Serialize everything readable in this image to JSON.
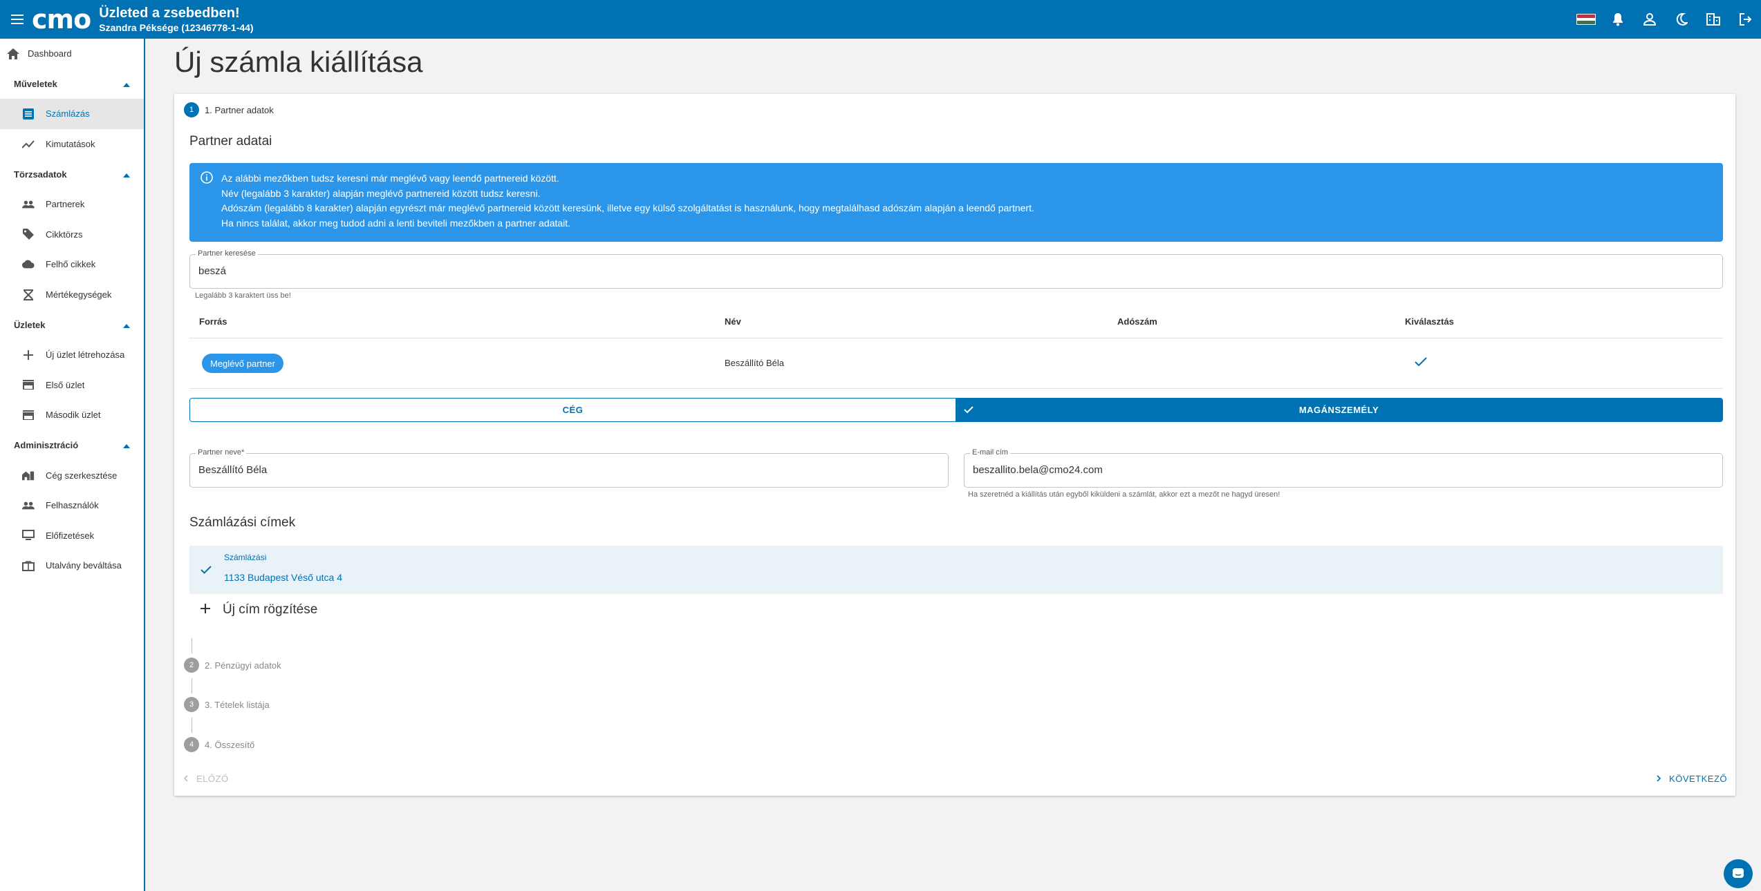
{
  "header": {
    "logo": "cmo",
    "title": "Üzleted a zsebedben!",
    "subtitle": "Szandra Péksége (12346778-1-44)",
    "icons": [
      "menu-icon",
      "hungarian-flag-icon",
      "bell-icon",
      "person-icon",
      "moon-icon",
      "building-icon",
      "logout-icon"
    ]
  },
  "sidebar": {
    "dashboard": "Dashboard",
    "sections": [
      {
        "title": "Műveletek",
        "items": [
          "Számlázás",
          "Kimutatások"
        ]
      },
      {
        "title": "Törzsadatok",
        "items": [
          "Partnerek",
          "Cikktörzs",
          "Felhő cikkek",
          "Mértékegységek"
        ]
      },
      {
        "title": "Üzletek",
        "items": [
          "Új üzlet létrehozása",
          "Első üzlet",
          "Második üzlet"
        ]
      },
      {
        "title": "Adminisztráció",
        "items": [
          "Cég szerkesztése",
          "Felhasználók",
          "Előfizetések",
          "Utalvány beváltása"
        ]
      }
    ]
  },
  "page": {
    "title": "Új számla kiállítása"
  },
  "stepper": {
    "step1": {
      "num": "1",
      "label": "1. Partner adatok"
    },
    "step2": {
      "num": "2",
      "label": "2. Pénzügyi adatok"
    },
    "step3": {
      "num": "3",
      "label": "3. Tételek listája"
    },
    "step4": {
      "num": "4",
      "label": "4. Összesítő"
    }
  },
  "partner": {
    "section_title": "Partner adatai",
    "info_lines": [
      "Az alábbi mezőkben tudsz keresni már meglévő vagy leendő partnereid között.",
      "Név (legalább 3 karakter) alapján meglévő partnereid között tudsz keresni.",
      "Adószám (legalább 8 karakter) alapján egyrészt már meglévő partnereid között keresünk, illetve egy külső szolgáltatást is használunk, hogy megtalálhasd adószám alapján a leendő partnert.",
      "Ha nincs találat, akkor meg tudod adni a lenti beviteli mezőkben a partner adatait."
    ],
    "search": {
      "label": "Partner keresése",
      "value": "beszá",
      "hint": "Legalább 3 karaktert üss be!"
    },
    "table": {
      "headers": [
        "Forrás",
        "Név",
        "Adószám",
        "Kiválasztás"
      ],
      "rows": [
        {
          "source": "Meglévő partner",
          "name": "Beszállító Béla",
          "tax": "",
          "selected": true
        }
      ]
    },
    "type_toggle": {
      "company": "CÉG",
      "private": "MAGÁNSZEMÉLY",
      "selected": "private"
    },
    "name_field": {
      "label": "Partner neve*",
      "value": "Beszállító Béla"
    },
    "email_field": {
      "label": "E-mail cím",
      "value": "beszallito.bela@cmo24.com",
      "hint": "Ha szeretnéd a kiállítás után egyből kiküldeni a számlát, akkor ezt a mezőt ne hagyd üresen!"
    }
  },
  "addresses": {
    "title": "Számlázási címek",
    "items": [
      {
        "type": "Számlázási",
        "address": "1133 Budapest Véső utca 4",
        "selected": true
      }
    ],
    "add_label": "Új cím rögzítése"
  },
  "nav": {
    "prev": "ELŐZŐ",
    "next": "KÖVETKEZŐ"
  },
  "colors": {
    "primary": "#0071b3",
    "info": "#2b96e9",
    "disabled": "#9e9e9e"
  }
}
